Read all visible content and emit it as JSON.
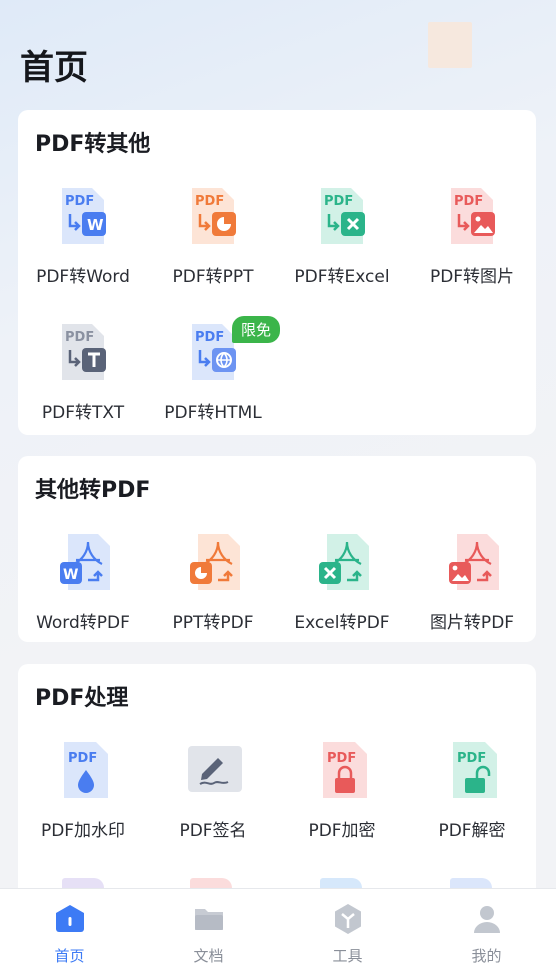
{
  "header": {
    "title": "首页"
  },
  "sections": [
    {
      "title": "PDF转其他",
      "tools": [
        {
          "label": "PDF转Word",
          "icon": "pdf-to-word-icon"
        },
        {
          "label": "PDF转PPT",
          "icon": "pdf-to-ppt-icon"
        },
        {
          "label": "PDF转Excel",
          "icon": "pdf-to-excel-icon"
        },
        {
          "label": "PDF转图片",
          "icon": "pdf-to-image-icon"
        },
        {
          "label": "PDF转TXT",
          "icon": "pdf-to-txt-icon"
        },
        {
          "label": "PDF转HTML",
          "icon": "pdf-to-html-icon",
          "badge": "限免"
        }
      ]
    },
    {
      "title": "其他转PDF",
      "tools": [
        {
          "label": "Word转PDF",
          "icon": "word-to-pdf-icon"
        },
        {
          "label": "PPT转PDF",
          "icon": "ppt-to-pdf-icon"
        },
        {
          "label": "Excel转PDF",
          "icon": "excel-to-pdf-icon"
        },
        {
          "label": "图片转PDF",
          "icon": "image-to-pdf-icon"
        }
      ]
    },
    {
      "title": "PDF处理",
      "tools": [
        {
          "label": "PDF加水印",
          "icon": "pdf-watermark-icon"
        },
        {
          "label": "PDF签名",
          "icon": "pdf-sign-icon"
        },
        {
          "label": "PDF加密",
          "icon": "pdf-encrypt-icon"
        },
        {
          "label": "PDF解密",
          "icon": "pdf-decrypt-icon"
        }
      ]
    }
  ],
  "tabbar": {
    "items": [
      {
        "label": "首页",
        "icon": "home-icon",
        "active": true
      },
      {
        "label": "文档",
        "icon": "folder-icon",
        "active": false
      },
      {
        "label": "工具",
        "icon": "toolbox-icon",
        "active": false
      },
      {
        "label": "我的",
        "icon": "user-icon",
        "active": false
      }
    ]
  },
  "colors": {
    "accent": "#3d7bf5",
    "word": "#4a7df0",
    "ppt": "#f07a3a",
    "excel": "#2bb48a",
    "image": "#e85a5a",
    "txt": "#5a6378",
    "badge": "#3bb54a"
  }
}
